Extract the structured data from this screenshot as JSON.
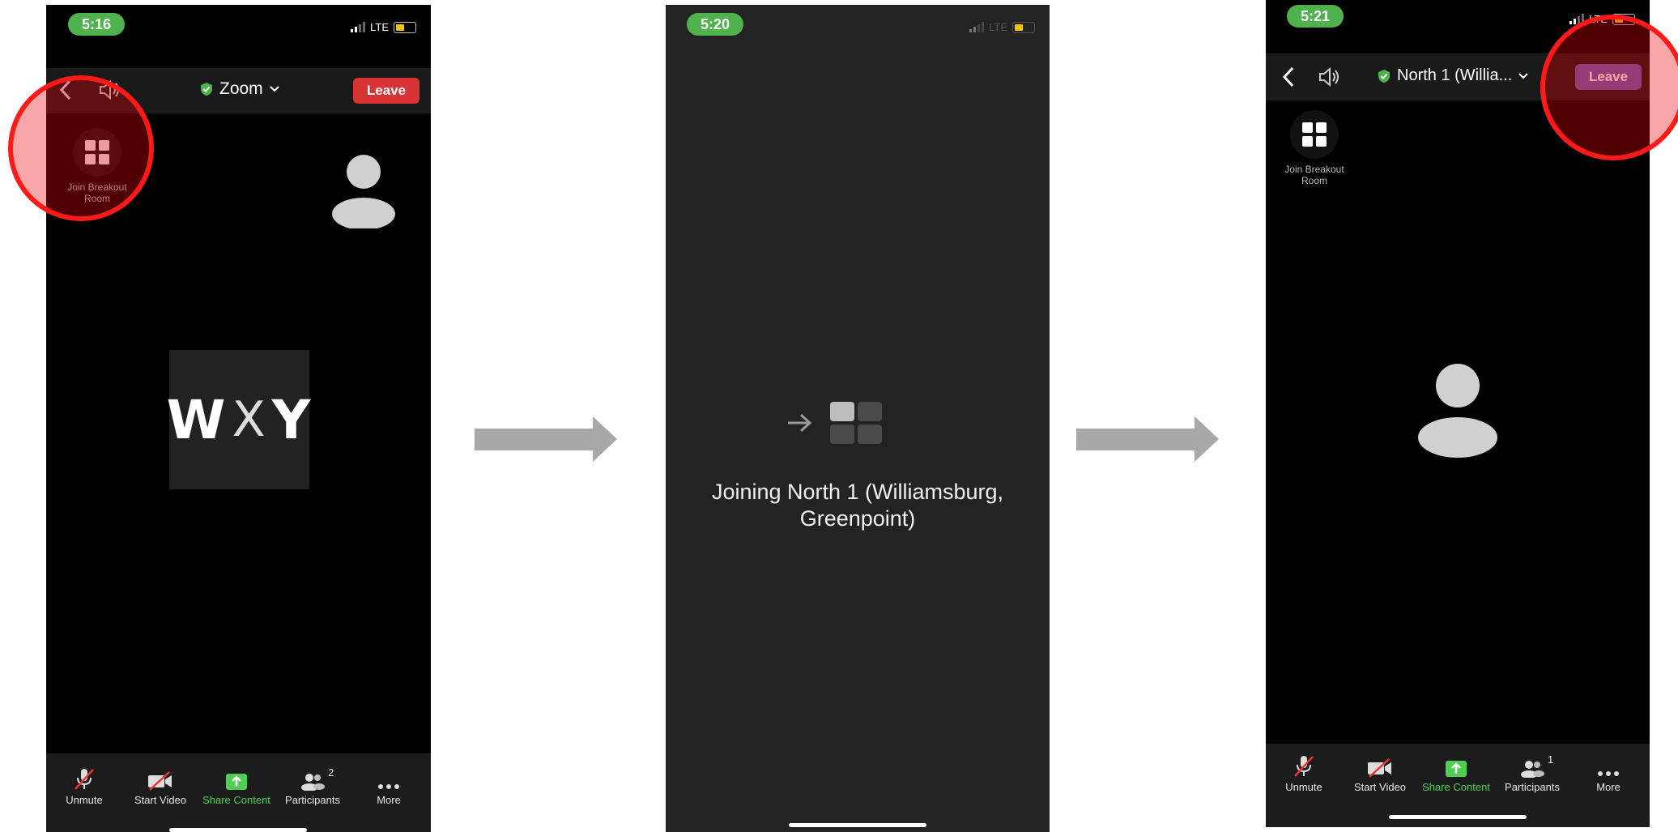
{
  "screens": [
    {
      "time": "5:16",
      "network": "LTE",
      "meeting_title": "Zoom",
      "leave_label": "Leave",
      "breakout_label": "Join Breakout Room",
      "logo_text": {
        "left": "W",
        "mid": "X",
        "right": "Y"
      },
      "toolbar": {
        "unmute": "Unmute",
        "start_video": "Start Video",
        "share": "Share Content",
        "participants": "Participants",
        "participants_count": "2",
        "more": "More"
      }
    },
    {
      "time": "5:20",
      "network": "LTE",
      "joining_line1": "Joining North 1 (Williamsburg,",
      "joining_line2": "Greenpoint)"
    },
    {
      "time": "5:21",
      "network": "LTE",
      "meeting_title": "North 1 (Willia...",
      "leave_label": "Leave",
      "breakout_label": "Join Breakout Room",
      "toolbar": {
        "unmute": "Unmute",
        "start_video": "Start Video",
        "share": "Share Content",
        "participants": "Participants",
        "participants_count": "1",
        "more": "More"
      }
    }
  ],
  "colors": {
    "status_green": "#4fb24d",
    "leave_red": "#d93434",
    "leave_purple": "#6c5bb5",
    "share_green": "#4fcf52",
    "highlight_red": "#ff1a1a"
  }
}
